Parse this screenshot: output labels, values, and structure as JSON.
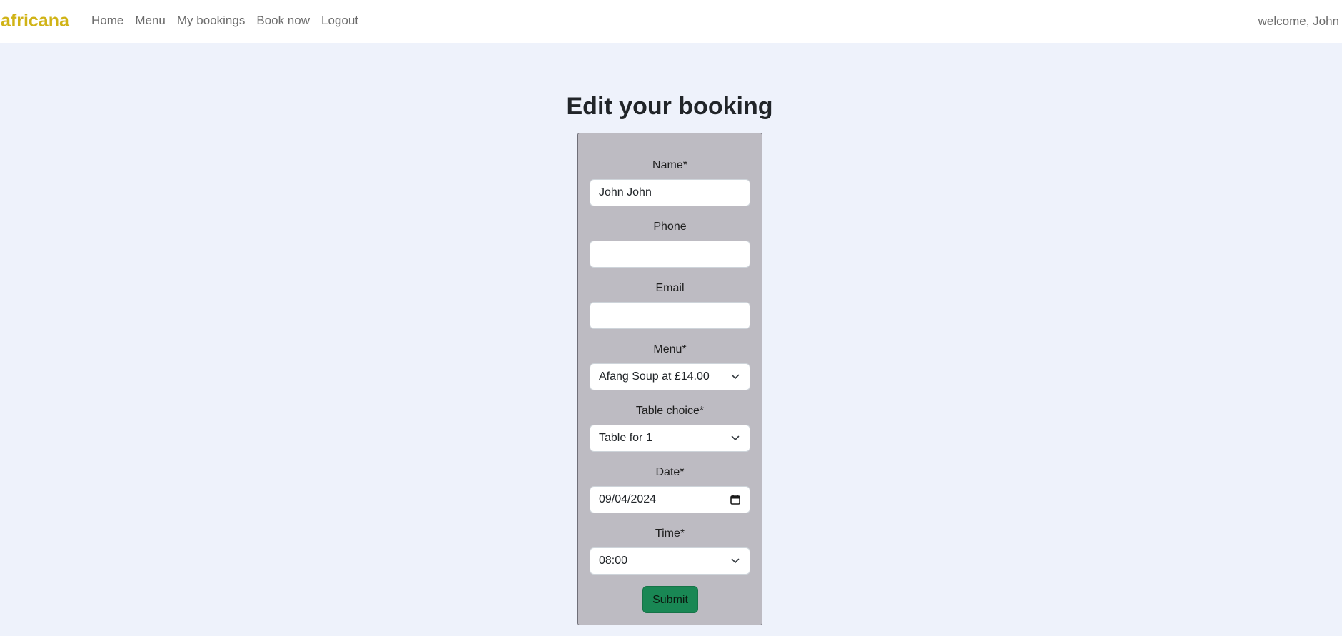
{
  "navbar": {
    "brand": "africana",
    "links": [
      {
        "label": "Home"
      },
      {
        "label": "Menu"
      },
      {
        "label": "My bookings"
      },
      {
        "label": "Book now"
      },
      {
        "label": "Logout"
      }
    ],
    "welcome": "welcome, John"
  },
  "page": {
    "title": "Edit your booking"
  },
  "form": {
    "name": {
      "label": "Name*",
      "value": "John John"
    },
    "phone": {
      "label": "Phone",
      "value": ""
    },
    "email": {
      "label": "Email",
      "value": ""
    },
    "menu": {
      "label": "Menu*",
      "selected": "Afang Soup at £14.00"
    },
    "table_choice": {
      "label": "Table choice*",
      "selected": "Table for 1"
    },
    "date": {
      "label": "Date*",
      "value": "09/04/2024"
    },
    "time": {
      "label": "Time*",
      "selected": "08:00"
    },
    "submit_label": "Submit"
  },
  "colors": {
    "brand": "#d0b316",
    "page_background": "#eef2fb",
    "card_background": "#bdbbc2",
    "submit_button": "#198754"
  },
  "icons": {
    "select_arrow": "chevron-down-icon",
    "date_picker": "calendar-icon"
  }
}
